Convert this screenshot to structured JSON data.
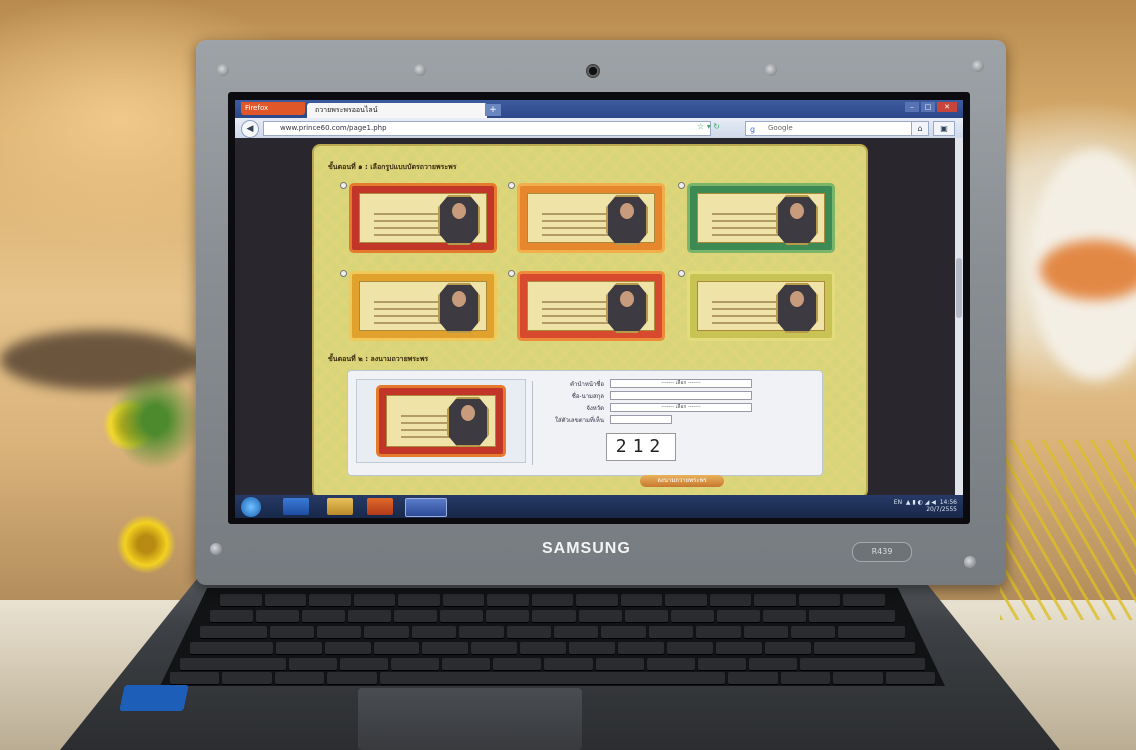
{
  "browser": {
    "app_button": "Firefox",
    "tab_title": "ถวายพระพรออนไลน์",
    "new_tab": "+",
    "url": "www.prince60.com/page1.php",
    "search_placeholder": "Google",
    "back_icon": "back-arrow-icon",
    "home_icon": "home-icon"
  },
  "page": {
    "section1_title": "ขั้นตอนที่ ๑ : เลือกรูปแบบบัตรถวายพระพร",
    "section2_title": "ขั้นตอนที่ ๒ : ลงนามถวายพระพร",
    "designs": [
      {
        "frame": "#c2362a",
        "border": "#e57a2c"
      },
      {
        "frame": "#e7872d",
        "border": "#f2ae4a"
      },
      {
        "frame": "#3e8a55",
        "border": "#7ab56a"
      },
      {
        "frame": "#e1a12d",
        "border": "#f1c95a"
      },
      {
        "frame": "#d84a2d",
        "border": "#ed8a3b"
      },
      {
        "frame": "#c9c254",
        "border": "#e2dc7a"
      }
    ],
    "form": {
      "title_label": "คำนำหน้าชื่อ",
      "title_value": "------- เลือก -------",
      "name_label": "ชื่อ-นามสกุล",
      "province_label": "จังหวัด",
      "province_value": "------- เลือก -------",
      "captcha_label": "ใส่ตัวเลขตามที่เห็น",
      "captcha_value": "212",
      "submit_label": "ลงนามถวายพระพร"
    }
  },
  "taskbar": {
    "language": "EN",
    "time": "14:56",
    "date": "20/7/2555"
  },
  "laptop": {
    "brand": "SAMSUNG",
    "model": "R439"
  }
}
